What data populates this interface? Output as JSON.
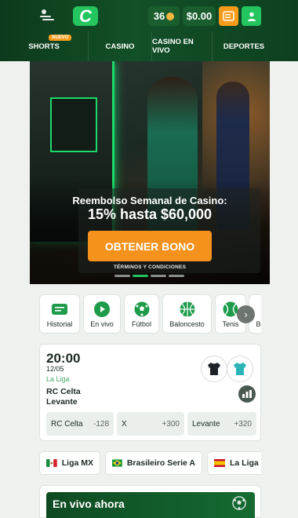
{
  "header": {
    "logo_letter": "C",
    "coins": "36",
    "balance": "$0.00",
    "icons": [
      "menu-icon",
      "wallet-icon",
      "user-icon",
      "coin-icon"
    ]
  },
  "nav": {
    "tabs": [
      {
        "label": "SHORTS",
        "badge": "NUEVO"
      },
      {
        "label": "CASINO"
      },
      {
        "label": "CASINO EN VIVO"
      },
      {
        "label": "DEPORTES"
      }
    ]
  },
  "banner": {
    "title": "Reembolso Semanal de Casino:",
    "subtitle": "15% hasta $60,000",
    "cta": "OBTENER BONO",
    "terms": "TÉRMINOS Y CONDICIONES",
    "slides": 4,
    "active_slide": 2
  },
  "categories": [
    {
      "label": "Historial",
      "icon": "ticket-icon"
    },
    {
      "label": "En vivo",
      "icon": "play-icon"
    },
    {
      "label": "Fútbol",
      "icon": "soccer-ball-icon"
    },
    {
      "label": "Baloncesto",
      "icon": "basketball-icon"
    },
    {
      "label": "Tenis",
      "icon": "tennis-ball-icon"
    },
    {
      "label": "Bo",
      "icon": "boxing-icon"
    }
  ],
  "match": {
    "time": "20:00",
    "date": "12/05",
    "league": "La Liga",
    "home": "RC Celta",
    "away": "Levante",
    "odds": [
      {
        "label": "RC Celta",
        "value": "-128"
      },
      {
        "label": "X",
        "value": "+300"
      },
      {
        "label": "Levante",
        "value": "+320"
      }
    ]
  },
  "leagues": [
    {
      "label": "Liga MX",
      "flag": "mexico"
    },
    {
      "label": "Brasileiro Serie A",
      "flag": "brazil"
    },
    {
      "label": "La Liga",
      "flag": "spain"
    }
  ],
  "live": {
    "title": "En vivo ahora"
  },
  "colors": {
    "brand_green": "#22c55e",
    "header_dark": "#0d3a1c",
    "orange": "#f5921e",
    "league_green": "#48a86a"
  }
}
